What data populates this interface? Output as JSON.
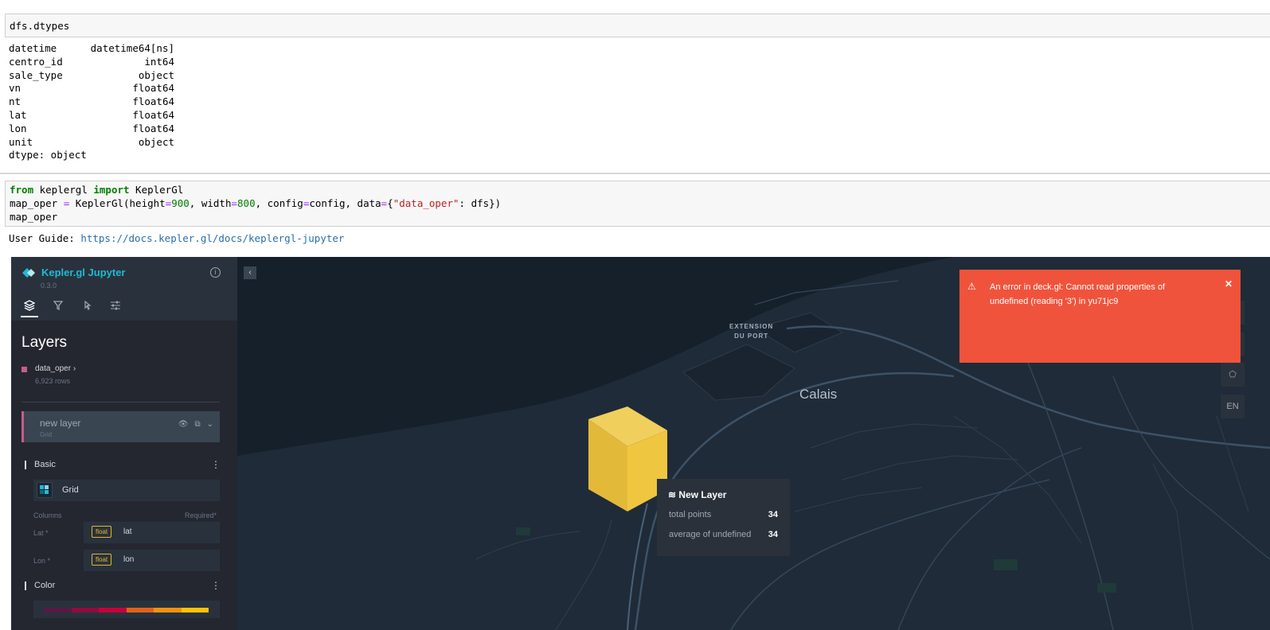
{
  "cell1": {
    "code": "dfs.dtypes"
  },
  "dtypes": {
    "rows": [
      {
        "name": "datetime",
        "type": "datetime64[ns]"
      },
      {
        "name": "centro_id",
        "type": "int64"
      },
      {
        "name": "sale_type",
        "type": "object"
      },
      {
        "name": "vn",
        "type": "float64"
      },
      {
        "name": "nt",
        "type": "float64"
      },
      {
        "name": "lat",
        "type": "float64"
      },
      {
        "name": "lon",
        "type": "float64"
      },
      {
        "name": "unit",
        "type": "object"
      }
    ],
    "footer": "dtype: object"
  },
  "cell2": {
    "kw_from": "from",
    "mod": " keplergl ",
    "kw_import": "import",
    "cls": " KeplerGl",
    "l2_a": "map_oper ",
    "l2_eq": "=",
    "l2_b": " KeplerGl(height",
    "l2_eq2": "=",
    "l2_h": "900",
    "l2_c": ", width",
    "l2_eq3": "=",
    "l2_w": "800",
    "l2_d": ", config",
    "l2_eq4": "=",
    "l2_e": "config, data",
    "l2_eq5": "=",
    "l2_f": "{",
    "l2_str": "\"data_oper\"",
    "l2_g": ": dfs})",
    "l3": "map_oper"
  },
  "guide": {
    "label": "User Guide: ",
    "url": "https://docs.kepler.gl/docs/keplergl-jupyter"
  },
  "kepler": {
    "brand": "Kepler.gl Jupyter",
    "version": "0.3.0",
    "panel_title": "Layers",
    "dataset": {
      "name": "data_oper",
      "rows": "6,923 rows",
      "color": "#c45e8e"
    },
    "layer": {
      "name": "new layer",
      "type": "Grid"
    },
    "sections": {
      "basic": "Basic",
      "color": "Color"
    },
    "vis_type": "Grid",
    "columns_label": "Columns",
    "required_label": "Required*",
    "fields": [
      {
        "label": "Lat *",
        "type": "float",
        "name": "lat"
      },
      {
        "label": "Lon *",
        "type": "float",
        "name": "lon"
      }
    ],
    "color_ramp": [
      "#5a1846",
      "#900c3f",
      "#c70039",
      "#e3611c",
      "#f1920e",
      "#ffc300"
    ],
    "map": {
      "label_port_1": "EXTENSION",
      "label_port_2": "DU PORT",
      "city": "Calais",
      "lang": "EN"
    },
    "tooltip": {
      "title": "New Layer",
      "rows": [
        {
          "label": "total points",
          "value": "34"
        },
        {
          "label": "average of undefined",
          "value": "34"
        }
      ]
    },
    "error": {
      "message": "An error in deck.gl: Cannot read properties of undefined (reading '3') in yu71jc9"
    }
  }
}
